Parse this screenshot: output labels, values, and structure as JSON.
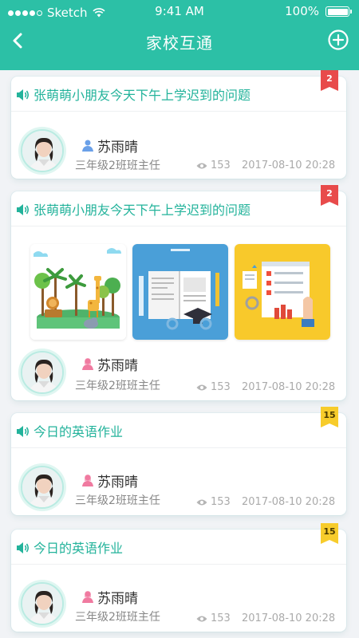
{
  "status_bar": {
    "carrier": "Sketch",
    "time": "9:41 AM",
    "battery": "100%"
  },
  "nav": {
    "title": "家校互通"
  },
  "posts": [
    {
      "title": "张萌萌小朋友今天下午上学迟到的问题",
      "badge": "2",
      "badge_color": "#e84b4b",
      "author": "苏雨晴",
      "author_gender": "male",
      "role": "三年级2班班主任",
      "views": "153",
      "date": "2017-08-10  20:28",
      "has_images": false
    },
    {
      "title": "张萌萌小朋友今天下午上学迟到的问题",
      "badge": "2",
      "badge_color": "#e84b4b",
      "author": "苏雨晴",
      "author_gender": "female",
      "role": "三年级2班班主任",
      "views": "153",
      "date": "2017-08-10  20:28",
      "has_images": true,
      "images": [
        "zoo-illustration",
        "education-book-illustration",
        "tutorial-illustration"
      ]
    },
    {
      "title": "今日的英语作业",
      "badge": "15",
      "badge_color": "#f7cc2b",
      "author": "苏雨晴",
      "author_gender": "female",
      "role": "三年级2班班主任",
      "views": "153",
      "date": "2017-08-10  20:28",
      "has_images": false
    },
    {
      "title": "今日的英语作业",
      "badge": "15",
      "badge_color": "#f7cc2b",
      "author": "苏雨晴",
      "author_gender": "female",
      "role": "三年级2班班主任",
      "views": "153",
      "date": "2017-08-10  20:28",
      "has_images": false
    }
  ],
  "colors": {
    "header": "#2cc0a6",
    "title_text": "#23b39b"
  }
}
